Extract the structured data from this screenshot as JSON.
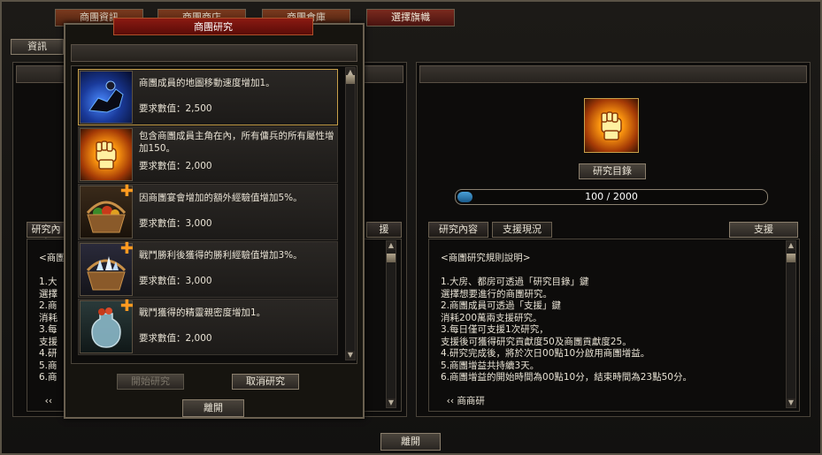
{
  "top_tabs": [
    {
      "label": "商團資訊"
    },
    {
      "label": "商團商店"
    },
    {
      "label": "商團倉庫"
    },
    {
      "label": "選擇旗幟"
    }
  ],
  "left_panel": {
    "tab_label": "資訊",
    "subtab_label": "研究內容",
    "right_subtab_label": "援",
    "rules_partial": "<商團\n\n1.大\n選擇\n2.商\n消耗\n3.每\n支援\n4.研\n5.商\n6.商\n\n  ‹‹"
  },
  "dialog": {
    "title": "商團研究",
    "items": [
      {
        "desc": "商團成員的地圖移動速度增加1。",
        "req": "要求數值：2,500",
        "icon": "rider-icon",
        "selected": true
      },
      {
        "desc": "包含商團成員主角在內，所有傭兵的所有屬性增加150。",
        "req": "要求數值：2,000",
        "icon": "fist-icon"
      },
      {
        "desc": "因商團宴會增加的額外經驗值增加5%。",
        "req": "要求數值：3,000",
        "icon": "basket-icon"
      },
      {
        "desc": "戰鬥勝利後獲得的勝利經驗值增加3%。",
        "req": "要求數值：3,000",
        "icon": "crystal-basket-icon"
      },
      {
        "desc": "戰鬥獲得的精靈親密度增加1。",
        "req": "要求數值：2,000",
        "icon": "jar-icon"
      }
    ],
    "start_button": "開始研究",
    "cancel_button": "取消研究",
    "close_button": "離開"
  },
  "right_panel": {
    "target_button": "研究目錄",
    "progress": {
      "current": 100,
      "max": 2000,
      "text": "100  /  2000"
    },
    "tabs": [
      "研究內容",
      "支援現況"
    ],
    "support_button": "支援",
    "rules": "<商團研究規則說明>\n\n1.大房、都房可透過「研究目錄」鍵\n選擇想要進行的商團研究。\n2.商團成員可透過「支援」鍵\n消耗200萬兩支援研究。\n3.每日僅可支援1次研究，\n支援後可獲得研究貢獻度50及商團貢獻度25。\n4.研究完成後，將於次日00點10分啟用商團增益。\n5.商團增益共持續3天。\n6.商團增益的開始時間為00點10分，結束時間為23點50分。\n\n  ‹‹ 商商研"
  },
  "close_button": "離開",
  "colors": {
    "accent_red": "#8a1a12",
    "progress_blue": "#2a7ab8",
    "selected_gold": "#c8a04a"
  }
}
